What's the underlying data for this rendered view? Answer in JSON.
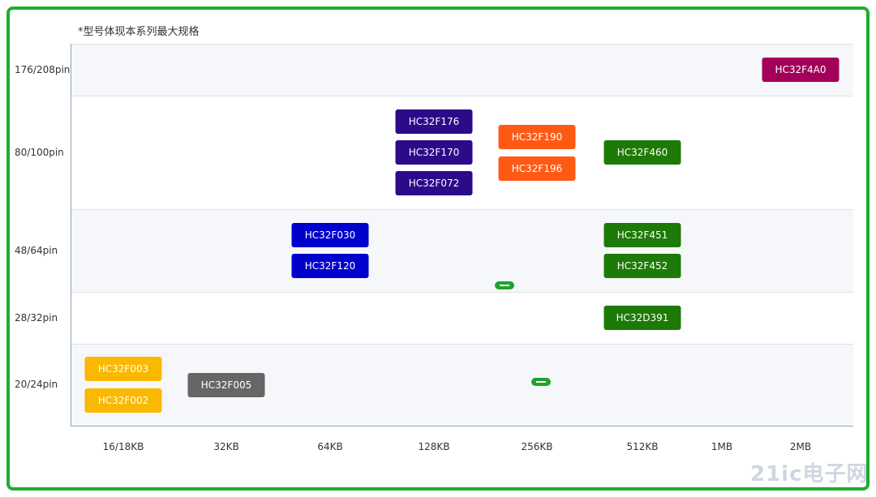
{
  "note": "*型号体现本系列最大规格",
  "watermark": {
    "text": "21ic",
    "sub": "电子网"
  },
  "chart_data": {
    "type": "table",
    "x_categories": [
      "16/18KB",
      "32KB",
      "64KB",
      "128KB",
      "256KB",
      "512KB",
      "1MB",
      "2MB"
    ],
    "y_categories": [
      "176/208pin",
      "80/100pin",
      "48/64pin",
      "28/32pin",
      "20/24pin"
    ],
    "series_colors": {
      "yellow": "#fbb800",
      "gray": "#666666",
      "blue": "#0000cc",
      "indigo": "#2c0a8a",
      "orange": "#ff5a14",
      "green": "#1e7a06",
      "magenta": "#a3005a"
    },
    "items": [
      {
        "label": "HC32F4A0",
        "x": "2MB",
        "y": "176/208pin",
        "color": "#a3005a"
      },
      {
        "label": "HC32F176",
        "x": "128KB",
        "y": "80/100pin",
        "color": "#2c0a8a"
      },
      {
        "label": "HC32F170",
        "x": "128KB",
        "y": "80/100pin",
        "color": "#2c0a8a"
      },
      {
        "label": "HC32F072",
        "x": "128KB",
        "y": "80/100pin",
        "color": "#2c0a8a"
      },
      {
        "label": "HC32F190",
        "x": "256KB",
        "y": "80/100pin",
        "color": "#ff5a14"
      },
      {
        "label": "HC32F196",
        "x": "256KB",
        "y": "80/100pin",
        "color": "#ff5a14"
      },
      {
        "label": "HC32F460",
        "x": "512KB",
        "y": "80/100pin",
        "color": "#1e7a06"
      },
      {
        "label": "HC32F030",
        "x": "64KB",
        "y": "48/64pin",
        "color": "#0000cc"
      },
      {
        "label": "HC32F120",
        "x": "64KB",
        "y": "48/64pin",
        "color": "#0000cc"
      },
      {
        "label": "HC32F451",
        "x": "512KB",
        "y": "48/64pin",
        "color": "#1e7a06"
      },
      {
        "label": "HC32F452",
        "x": "512KB",
        "y": "48/64pin",
        "color": "#1e7a06"
      },
      {
        "label": "HC32D391",
        "x": "512KB",
        "y": "28/32pin",
        "color": "#1e7a06"
      },
      {
        "label": "HC32F003",
        "x": "16/18KB",
        "y": "20/24pin",
        "color": "#fbb800"
      },
      {
        "label": "HC32F002",
        "x": "16/18KB",
        "y": "20/24pin",
        "color": "#fbb800"
      },
      {
        "label": "HC32F005",
        "x": "32KB",
        "y": "20/24pin",
        "color": "#666666"
      }
    ],
    "markers": [
      {
        "type": "pill",
        "between_x": "128KB-256KB",
        "y": "48/64pin",
        "color": "#20a32b"
      },
      {
        "type": "pill",
        "x": "256KB",
        "y": "20/24pin",
        "color": "#20a32b"
      }
    ]
  }
}
